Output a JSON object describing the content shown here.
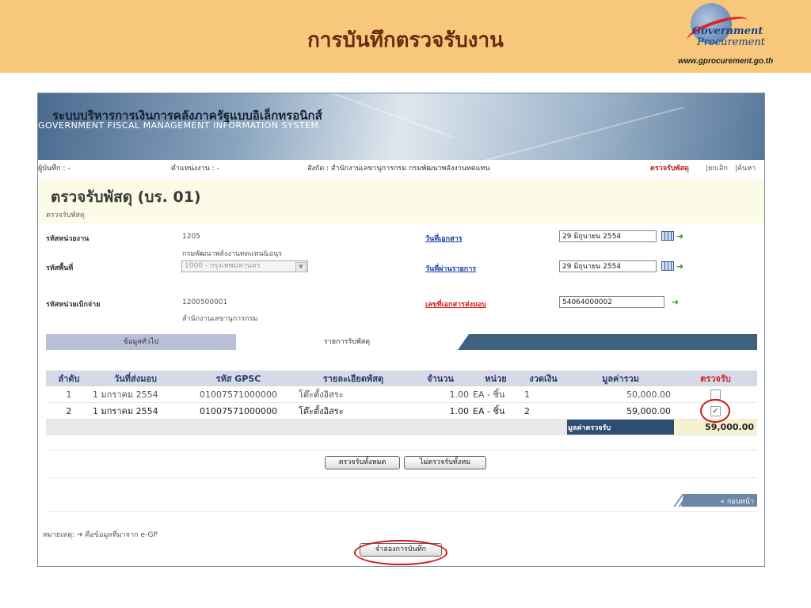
{
  "slide": {
    "title": "การบันทึกตรวจรับงาน",
    "logo_line1": "Government",
    "logo_line2": "Procurement",
    "logo_url": "www.gprocurement.go.th"
  },
  "banner": {
    "title_th": "ระบบบริหารการเงินการคลังภาครัฐแบบอิเล็กทรอนิกส์",
    "title_en": "GOVERNMENT FISCAL MANAGEMENT INFORMATION SYSTEM"
  },
  "userbar": {
    "recorder": "ผู้บันทึก : -",
    "position": "ตำแหน่งงาน : -",
    "affiliation": "สังกัด : สำนักงานเลขานุการกรม กรมพัฒนาพลังงานทดแทน",
    "active_item": "ตรวจรับพัสดุ",
    "cancel": "|ยกเลิก",
    "search": "|ค้นหา"
  },
  "page": {
    "title": "ตรวจรับพัสดุ (บร. 01)",
    "subtitle": "ตรวจรับพัสดุ"
  },
  "form": {
    "unit_code_label": "รหัสหน่วยงาน",
    "unit_code": "1205",
    "unit_name": "กรมพัฒนาพลังงานทดแทน&อนุร",
    "area_code_label": "รหัสพื้นที่",
    "area_code_value": "1000 - กรุงเทพมหานคร",
    "disb_unit_label": "รหัสหน่วยเบิกจ่าย",
    "disb_unit_code": "1200500001",
    "disb_unit_name": "สำนักงานเลขานุการกรม",
    "doc_date_label": "วันที่เอกสาร",
    "doc_date": "29 มิถุนายน 2554",
    "post_date_label": "วันที่ผ่านรายการ",
    "post_date": "29 มิถุนายน 2554",
    "delivery_no_label": "เลขที่เอกสารส่งมอบ",
    "delivery_no": "54064000002"
  },
  "tabs": {
    "general": "ข้อมูลทั่วไป",
    "items": "รายการรับพัสดุ"
  },
  "table": {
    "headers": [
      "ลำดับ",
      "วันที่ส่งมอบ",
      "รหัส GPSC",
      "รายละเอียดพัสดุ",
      "จำนวน",
      "หน่วย",
      "งวดเงิน",
      "มูลค่ารวม",
      "ตรวจรับ"
    ],
    "rows": [
      {
        "no": "1",
        "date": "1 มกราคม 2554",
        "gpsc": "01007571000000",
        "desc": "โต๊ะตั้งอิสระ",
        "qty": "1.00",
        "unit": "EA - ชิ้น",
        "installment": "1",
        "total": "50,000.00",
        "checked": false
      },
      {
        "no": "2",
        "date": "1 มกราคม 2554",
        "gpsc": "01007571000000",
        "desc": "โต๊ะตั้งอิสระ",
        "qty": "1.00",
        "unit": "EA - ชิ้น",
        "installment": "2",
        "total": "59,000.00",
        "checked": true
      }
    ],
    "check_mark": "✓",
    "total_label": "มูลค่าตรวจรับ",
    "total_value": "59,000.00"
  },
  "buttons": {
    "check_all": "ตรวจรับทั้งหมด",
    "uncheck_all": "ไม่ตรวจรับทั้งหม",
    "prev": "« ก่อนหน้า",
    "simulate_save": "จำลองการบันทึก"
  },
  "note": {
    "label": "หมายเหตุ:",
    "text": "คือข้อมูลที่มาจาก e-GP"
  },
  "colors": {
    "header_bg": "#f7c87c",
    "title_color": "#6b2a10",
    "highlight_circle": "#d01818"
  }
}
